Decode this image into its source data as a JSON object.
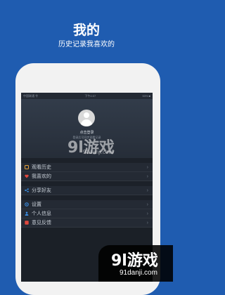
{
  "promo": {
    "title": "我的",
    "subtitle": "历史记录我喜欢的"
  },
  "status_bar": {
    "carrier": "中国联通 令",
    "time": "下午4:07",
    "battery": "53% ■"
  },
  "profile": {
    "login_text": "点击登录",
    "login_hint": "登录后可同步观看记录"
  },
  "menu": [
    {
      "label": "观看历史",
      "icon": "history-icon",
      "color": "#e6a23c"
    },
    {
      "label": "我喜欢的",
      "icon": "heart-icon",
      "color": "#e0483e"
    },
    {
      "label": "分享好友",
      "icon": "share-icon",
      "color": "#3b8fe6"
    },
    {
      "label": "设置",
      "icon": "settings-icon",
      "color": "#3b8fe6"
    },
    {
      "label": "个人信息",
      "icon": "person-icon",
      "color": "#3b8fe6"
    },
    {
      "label": "意见反馈",
      "icon": "feedback-icon",
      "color": "#e0483e"
    }
  ],
  "watermark": {
    "logo": "9l游戏",
    "url": "91danji.com"
  }
}
